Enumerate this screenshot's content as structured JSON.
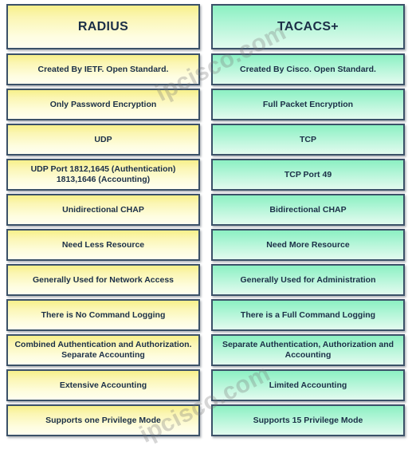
{
  "watermark": {
    "text": "ipcisco.com",
    "occurrences": 2,
    "color": "#787878"
  },
  "colors": {
    "left_column_fill_top": "#f7f08a",
    "left_column_fill_bottom": "#fffef0",
    "right_column_fill_top": "#8cf0c2",
    "right_column_fill_bottom": "#e2fbef",
    "border": "#3b5168",
    "text": "#1b2f47",
    "background": "#ffffff"
  },
  "table": {
    "headers": {
      "left": "RADIUS",
      "right": "TACACS+"
    },
    "rows": [
      {
        "left": "Created By IETF. Open Standard.",
        "right": "Created By Cisco. Open Standard."
      },
      {
        "left": "Only Password Encryption",
        "right": "Full Packet Encryption"
      },
      {
        "left": "UDP",
        "right": "TCP"
      },
      {
        "left": "UDP Port 1812,1645 (Authentication) 1813,1646 (Accounting)",
        "right": "TCP Port 49"
      },
      {
        "left": "Unidirectional CHAP",
        "right": "Bidirectional CHAP"
      },
      {
        "left": "Need Less Resource",
        "right": "Need More Resource"
      },
      {
        "left": "Generally Used for Network Access",
        "right": "Generally Used for Administration"
      },
      {
        "left": "There is No Command Logging",
        "right": "There is  a Full Command Logging"
      },
      {
        "left": "Combined Authentication and Authorization. Separate Accounting",
        "right": "Separate Authentication, Authorization and Accounting"
      },
      {
        "left": "Extensive Accounting",
        "right": "Limited Accounting"
      },
      {
        "left": "Supports one Privilege Mode",
        "right": "Supports 15 Privilege Mode"
      }
    ]
  }
}
